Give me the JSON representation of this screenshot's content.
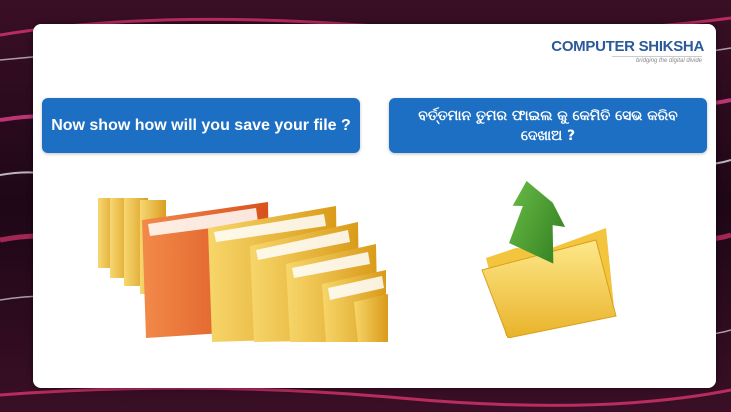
{
  "logo": {
    "brand": "COMPUTER SHIKSHA",
    "tagline": "bridging the digital divide"
  },
  "banners": {
    "english": "Now show how will you save your file ?",
    "odia": "ବର୍ତ୍ତମାନ ତୁମର ଫାଇଲ କୁ କେମିତି ସେଭ କରିବ ଦେଖାଅ ?"
  },
  "colors": {
    "banner": "#1d6fc3",
    "background": "#2a0b1c",
    "folder_yellow": "#f2c330",
    "folder_orange": "#e8622a",
    "arrow_green": "#3c8a2a"
  },
  "icons": [
    "folders-row-illustration",
    "folder-save-arrow-icon"
  ]
}
